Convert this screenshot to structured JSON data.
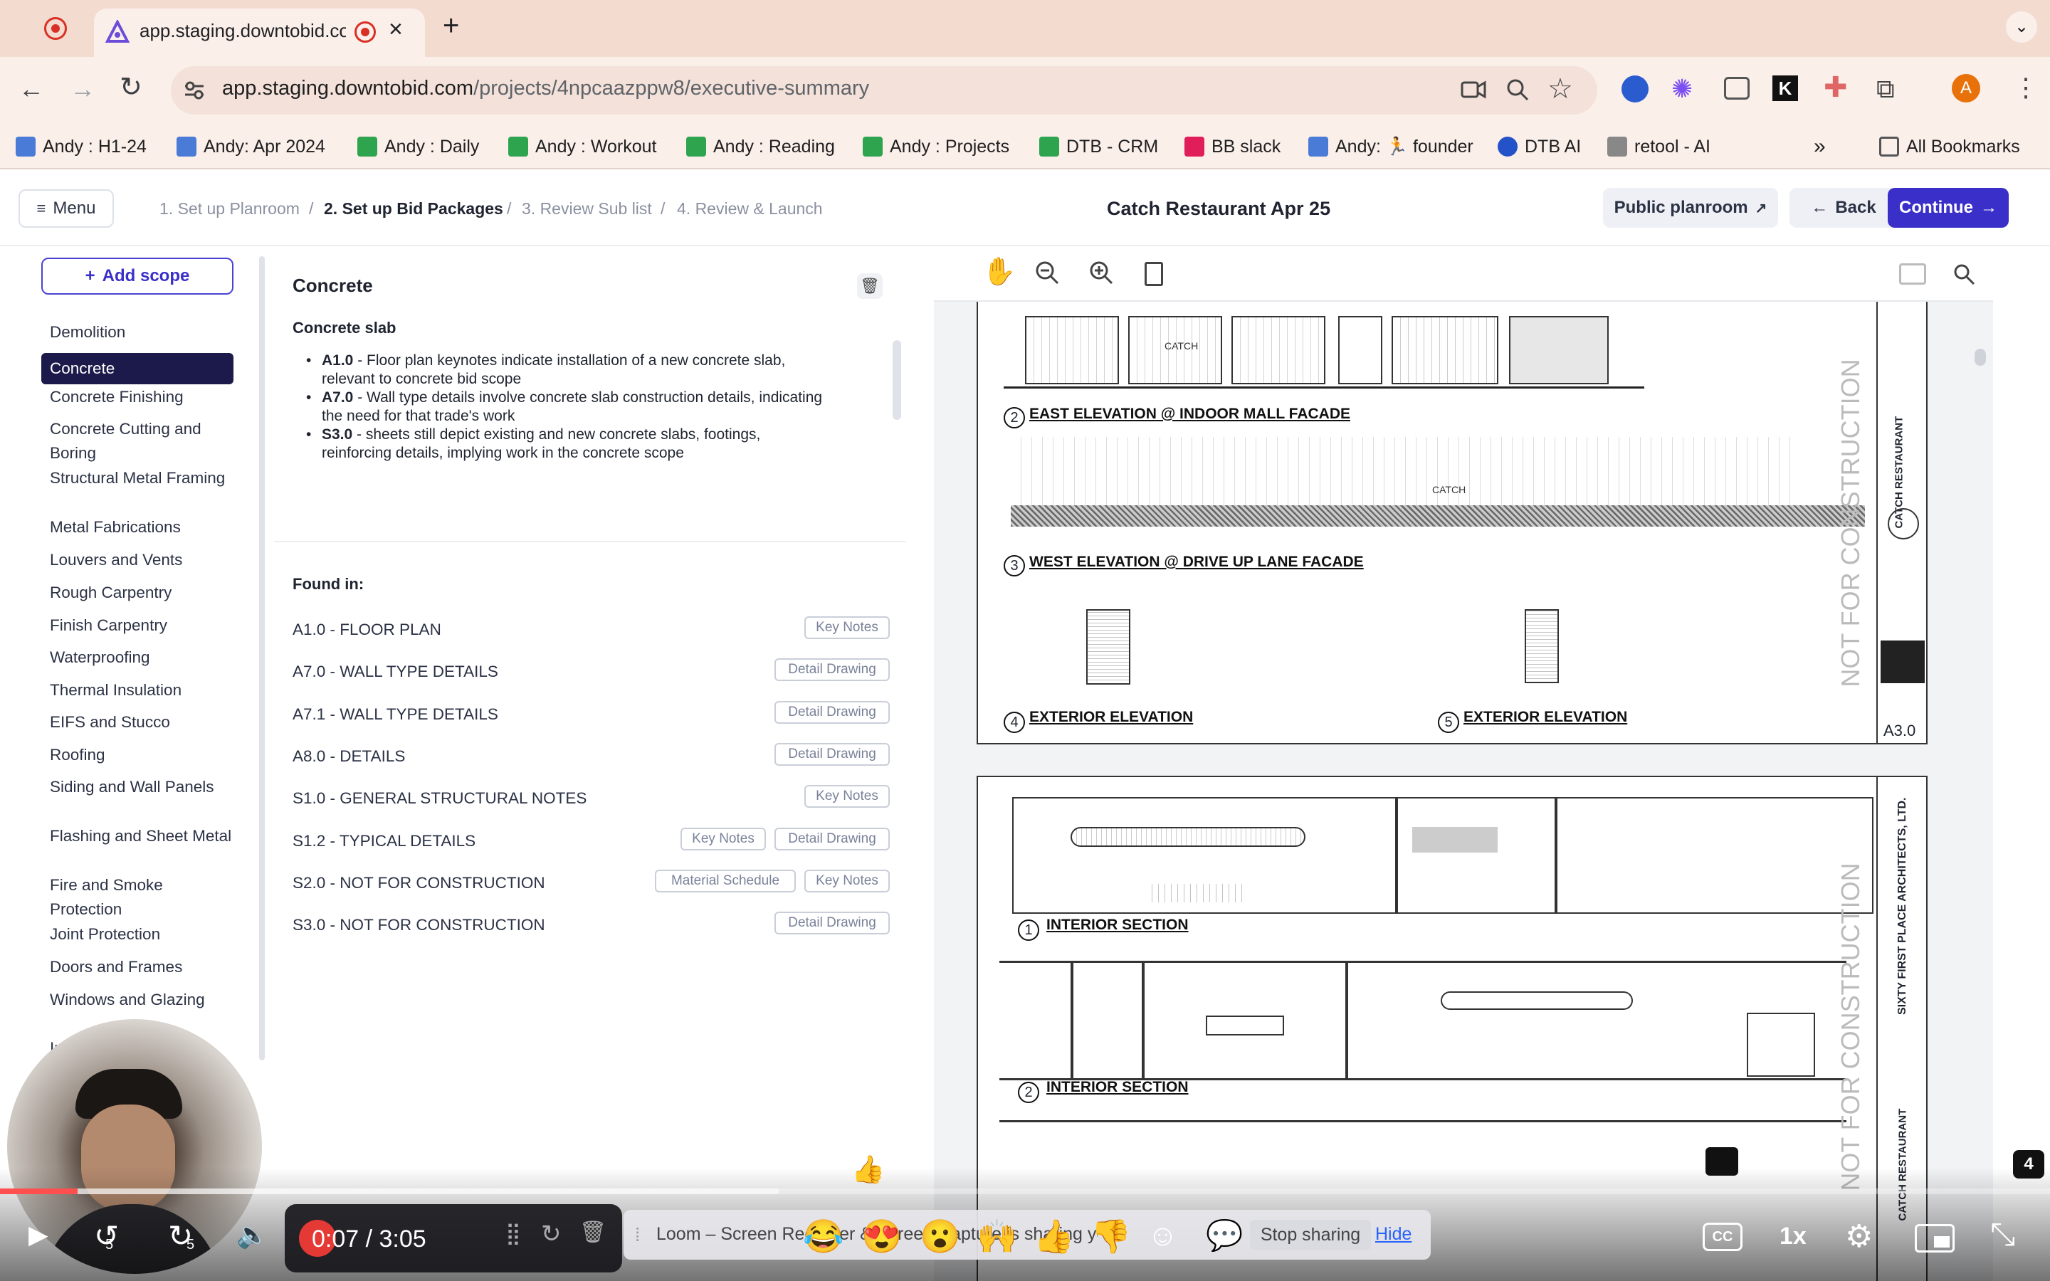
{
  "browser": {
    "tab_title": "app.staging.downtobid.co",
    "url_host": "app.staging.downtobid.com",
    "url_path": "/projects/4npcaazppw8/executive-summary",
    "bookmarks": [
      "Andy : H1-24",
      "Andy: Apr 2024",
      "Andy : Daily",
      "Andy : Workout",
      "Andy : Reading",
      "Andy : Projects",
      "DTB - CRM",
      "BB slack",
      "Andy: 🏃 founder",
      "DTB AI",
      "retool - AI"
    ],
    "all_bookmarks": "All Bookmarks",
    "profile_initial": "A",
    "overflow": "»"
  },
  "header": {
    "menu": "Menu",
    "steps": [
      "1. Set up Planroom",
      "2. Set up Bid Packages",
      "3. Review Sub list",
      "4. Review & Launch"
    ],
    "separator": "/",
    "project_title": "Catch Restaurant Apr 25",
    "public_planroom": "Public planroom",
    "back": "Back",
    "continue": "Continue"
  },
  "sidebar": {
    "add_scope": "Add scope",
    "items": [
      "Demolition",
      "Concrete",
      "Concrete Finishing",
      "Concrete Cutting and Boring",
      "Structural Metal Framing",
      "Metal Fabrications",
      "Louvers and Vents",
      "Rough Carpentry",
      "Finish Carpentry",
      "Waterproofing",
      "Thermal Insulation",
      "EIFS and Stucco",
      "Roofing",
      "Siding and Wall Panels",
      "Flashing and Sheet Metal",
      "Fire and Smoke Protection",
      "Joint Protection",
      "Doors and Frames",
      "Windows and Glazing",
      "Interior Specialties"
    ],
    "active": "Concrete"
  },
  "scope_detail": {
    "title": "Concrete",
    "subtitle": "Concrete slab",
    "bullets": [
      {
        "code": "A1.0",
        "text": " - Floor plan keynotes indicate installation of a new concrete slab, relevant to concrete bid scope"
      },
      {
        "code": "A7.0",
        "text": " - Wall type details involve concrete slab construction details, indicating the need for that trade's work"
      },
      {
        "code": "S3.0",
        "text": " - sheets still depict existing and new concrete slabs, footings, reinforcing details, implying work in the concrete scope"
      }
    ],
    "found_in_label": "Found in:",
    "found_in": [
      {
        "sheet": "A1.0 - FLOOR PLAN",
        "tags": [
          "Key Notes"
        ]
      },
      {
        "sheet": "A7.0 - WALL TYPE DETAILS",
        "tags": [
          "Detail Drawing"
        ]
      },
      {
        "sheet": "A7.1 - WALL TYPE DETAILS",
        "tags": [
          "Detail Drawing"
        ]
      },
      {
        "sheet": "A8.0 - DETAILS",
        "tags": [
          "Detail Drawing"
        ]
      },
      {
        "sheet": "S1.0 - GENERAL STRUCTURAL NOTES",
        "tags": [
          "Key Notes"
        ]
      },
      {
        "sheet": "S1.2 - TYPICAL DETAILS",
        "tags": [
          "Key Notes",
          "Detail Drawing"
        ]
      },
      {
        "sheet": "S2.0 - NOT FOR CONSTRUCTION",
        "tags": [
          "Material Schedule",
          "Key Notes"
        ]
      },
      {
        "sheet": "S3.0 - NOT FOR CONSTRUCTION",
        "tags": [
          "Detail Drawing"
        ]
      }
    ]
  },
  "drawing": {
    "labels": [
      "EAST ELEVATION @ INDOOR MALL FACADE",
      "WEST ELEVATION @ DRIVE UP LANE FACADE",
      "EXTERIOR ELEVATION",
      "EXTERIOR ELEVATION",
      "INTERIOR SECTION",
      "INTERIOR SECTION"
    ],
    "numbers": [
      "2",
      "3",
      "4",
      "5",
      "1",
      "2"
    ],
    "stamp": "NOT FOR CONSTRUCTION",
    "sheet_no": "A3.0",
    "title_block_1": "CATCH RESTAURANT",
    "title_block_2": "SIXTY FIRST PLACE ARCHITECTS, LTD.",
    "catch_mark": "CATCH"
  },
  "video": {
    "time": "0:07 / 3:05",
    "speed": "1x",
    "skip_back": "5",
    "skip_fwd": "5",
    "progress": 0.038,
    "buffered": 0.38,
    "loom_text": "Loom – Screen Recorder & Screen Capture is sharing your screen.",
    "stop_sharing": "Stop sharing",
    "hide": "Hide",
    "reactions": [
      "😂",
      "😍",
      "😮",
      "🙌",
      "👍",
      "👎"
    ],
    "thumb": "👍",
    "badge": "4"
  }
}
